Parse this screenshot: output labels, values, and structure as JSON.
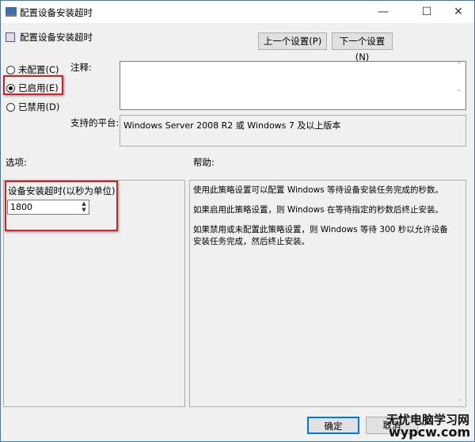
{
  "window": {
    "title": "配置设备安装超时",
    "minimize": "—",
    "maximize": "☐",
    "close": "✕"
  },
  "header": {
    "title": "配置设备安装超时",
    "prev_button": "上一个设置(P)",
    "next_button": "下一个设置(N)"
  },
  "state": {
    "options": [
      {
        "label": "未配置(C)",
        "checked": false
      },
      {
        "label": "已启用(E)",
        "checked": true
      },
      {
        "label": "已禁用(D)",
        "checked": false
      }
    ]
  },
  "comment": {
    "label": "注释:",
    "value": ""
  },
  "platform": {
    "label": "支持的平台:",
    "value": "Windows Server 2008 R2 或 Windows 7 及以上版本"
  },
  "options_panel": {
    "label": "选项:",
    "field_label": "设备安装超时(以秒为单位)",
    "field_value": "1800"
  },
  "help_panel": {
    "label": "帮助:",
    "paragraphs": [
      "使用此策略设置可以配置 Windows 等待设备安装任务完成的秒数。",
      "如果启用此策略设置，则 Windows 在等待指定的秒数后终止安装。",
      "如果禁用或未配置此策略设置，则 Windows 等待 300 秒以允许设备安装任务完成，然后终止安装。"
    ]
  },
  "footer": {
    "ok_button": "确定",
    "cancel_button": "取消"
  },
  "watermark": {
    "line1": "无忧电脑学习网",
    "line2": "wypcw.com"
  }
}
